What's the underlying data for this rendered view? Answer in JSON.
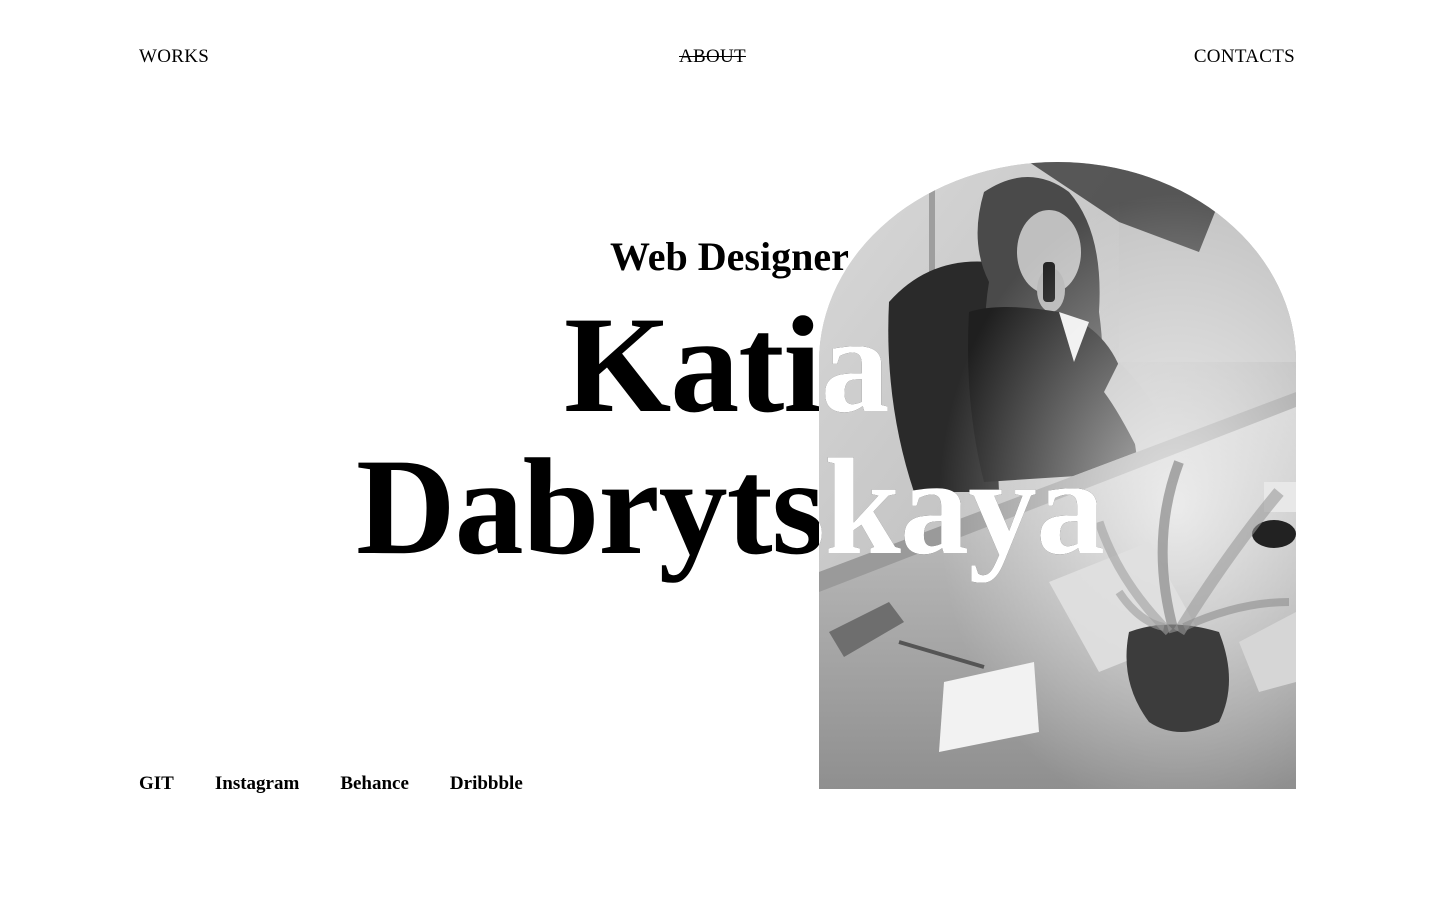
{
  "nav": {
    "works": "WORKS",
    "about": "ABOUT",
    "contacts": "CONTACTS"
  },
  "hero": {
    "subtitle": "Web Designer",
    "first_name": "Katia",
    "last_name": "Dabrytskaya"
  },
  "photo": {
    "alt": "Grayscale photo of a woman talking on the phone at an office desk with a plant"
  },
  "social": {
    "links": [
      "GIT",
      "Instagram",
      "Behance",
      "Dribbble"
    ]
  },
  "colors": {
    "background": "#ffffff",
    "text": "#000000",
    "overlay_text": "#ffffff"
  }
}
